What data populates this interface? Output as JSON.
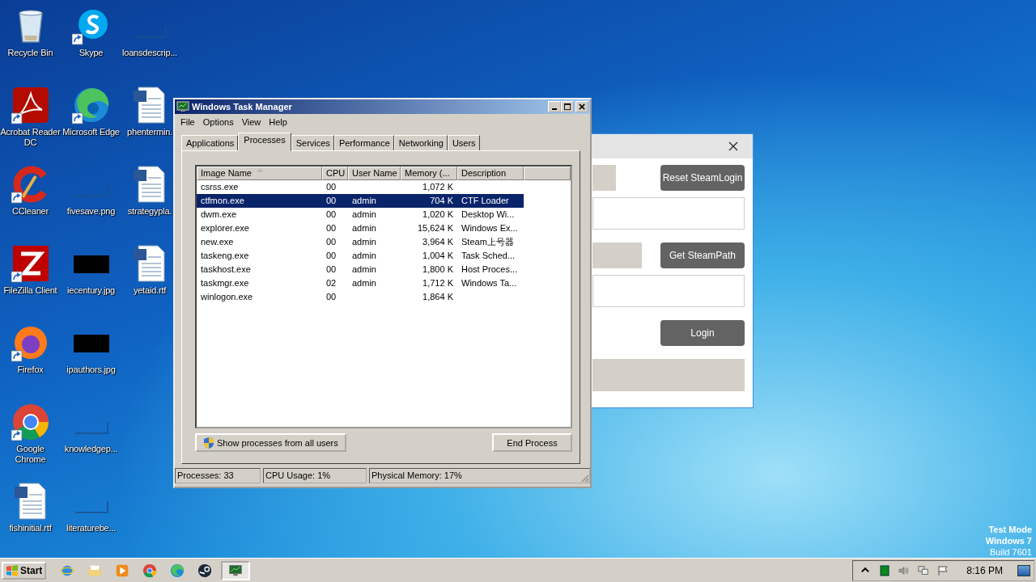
{
  "desktop_icons": [
    {
      "label": "Recycle Bin",
      "kind": "recycle",
      "shortcut": false
    },
    {
      "label": "Acrobat Reader DC",
      "kind": "acrobat",
      "shortcut": true
    },
    {
      "label": "CCleaner",
      "kind": "ccleaner",
      "shortcut": true
    },
    {
      "label": "FileZilla Client",
      "kind": "filezilla",
      "shortcut": true
    },
    {
      "label": "Firefox",
      "kind": "firefox",
      "shortcut": true
    },
    {
      "label": "Google Chrome",
      "kind": "chrome",
      "shortcut": true
    },
    {
      "label": "fishinitial.rtf",
      "kind": "document",
      "shortcut": false
    },
    {
      "label": "Skype",
      "kind": "skype",
      "shortcut": true
    },
    {
      "label": "Microsoft Edge",
      "kind": "edge",
      "shortcut": true
    },
    {
      "label": "fivesave.png",
      "kind": "blank",
      "shortcut": false
    },
    {
      "label": "iecentury.jpg",
      "kind": "dark",
      "shortcut": false
    },
    {
      "label": "ipauthors.jpg",
      "kind": "dark",
      "shortcut": false
    },
    {
      "label": "knowledgep...",
      "kind": "blank",
      "shortcut": false
    },
    {
      "label": "literaturebe...",
      "kind": "blank",
      "shortcut": false
    },
    {
      "label": "loansdescrip...",
      "kind": "blank",
      "shortcut": false
    },
    {
      "label": "phentermin.",
      "kind": "document",
      "shortcut": false
    },
    {
      "label": "strategypla.",
      "kind": "document",
      "shortcut": false
    },
    {
      "label": "yetaid.rtf",
      "kind": "document",
      "shortcut": false
    }
  ],
  "steam_window": {
    "buttons": [
      "Reset SteamLogin",
      "Get SteamPath",
      "Login"
    ]
  },
  "task_manager": {
    "title": "Windows Task Manager",
    "menu": [
      "File",
      "Options",
      "View",
      "Help"
    ],
    "tabs": [
      {
        "label": "Applications",
        "selected": false
      },
      {
        "label": "Processes",
        "selected": true
      },
      {
        "label": "Services",
        "selected": false
      },
      {
        "label": "Performance",
        "selected": false
      },
      {
        "label": "Networking",
        "selected": false
      },
      {
        "label": "Users",
        "selected": false
      }
    ],
    "columns": [
      {
        "label": "Image Name",
        "sorted": true
      },
      {
        "label": "CPU",
        "sorted": false
      },
      {
        "label": "User Name",
        "sorted": false
      },
      {
        "label": "Memory (...",
        "sorted": false
      },
      {
        "label": "Description",
        "sorted": false
      }
    ],
    "rows": [
      {
        "name": "csrss.exe",
        "cpu": "00",
        "memory": "1,072 K",
        "selected": false
      },
      {
        "name": "ctfmon.exe",
        "cpu": "00",
        "user": "admin",
        "memory": "704 K",
        "description": "CTF Loader",
        "selected": true
      },
      {
        "name": "dwm.exe",
        "cpu": "00",
        "user": "admin",
        "memory": "1,020 K",
        "description": "Desktop Wi...",
        "selected": false
      },
      {
        "name": "explorer.exe",
        "cpu": "00",
        "user": "admin",
        "memory": "15,624 K",
        "description": "Windows Ex...",
        "selected": false
      },
      {
        "name": "new.exe",
        "cpu": "00",
        "user": "admin",
        "memory": "3,964 K",
        "description": "Steam上号器",
        "selected": false
      },
      {
        "name": "taskeng.exe",
        "cpu": "00",
        "user": "admin",
        "memory": "1,004 K",
        "description": "Task Sched...",
        "selected": false
      },
      {
        "name": "taskhost.exe",
        "cpu": "00",
        "user": "admin",
        "memory": "1,800 K",
        "description": "Host Proces...",
        "selected": false
      },
      {
        "name": "taskmgr.exe",
        "cpu": "02",
        "user": "admin",
        "memory": "1,712 K",
        "description": "Windows Ta...",
        "selected": false
      },
      {
        "name": "winlogon.exe",
        "cpu": "00",
        "memory": "1,864 K",
        "selected": false
      }
    ],
    "show_all_button": "Show processes from all users",
    "end_button": "End Process",
    "status_bar": [
      "Processes: 33",
      "CPU Usage: 1%",
      "Physical Memory: 17%"
    ]
  },
  "os_notice": [
    "Test Mode",
    "Windows 7",
    "Build 7601"
  ],
  "taskbar": {
    "start": "Start",
    "apps": [
      {
        "kind": "ie",
        "active": false
      },
      {
        "kind": "folder",
        "active": false
      },
      {
        "kind": "media",
        "active": false
      },
      {
        "kind": "chrome",
        "active": false
      },
      {
        "kind": "edge",
        "active": false
      },
      {
        "kind": "steam",
        "active": false
      },
      {
        "kind": "monitor",
        "active": true
      }
    ],
    "clock": "8:16 PM"
  }
}
